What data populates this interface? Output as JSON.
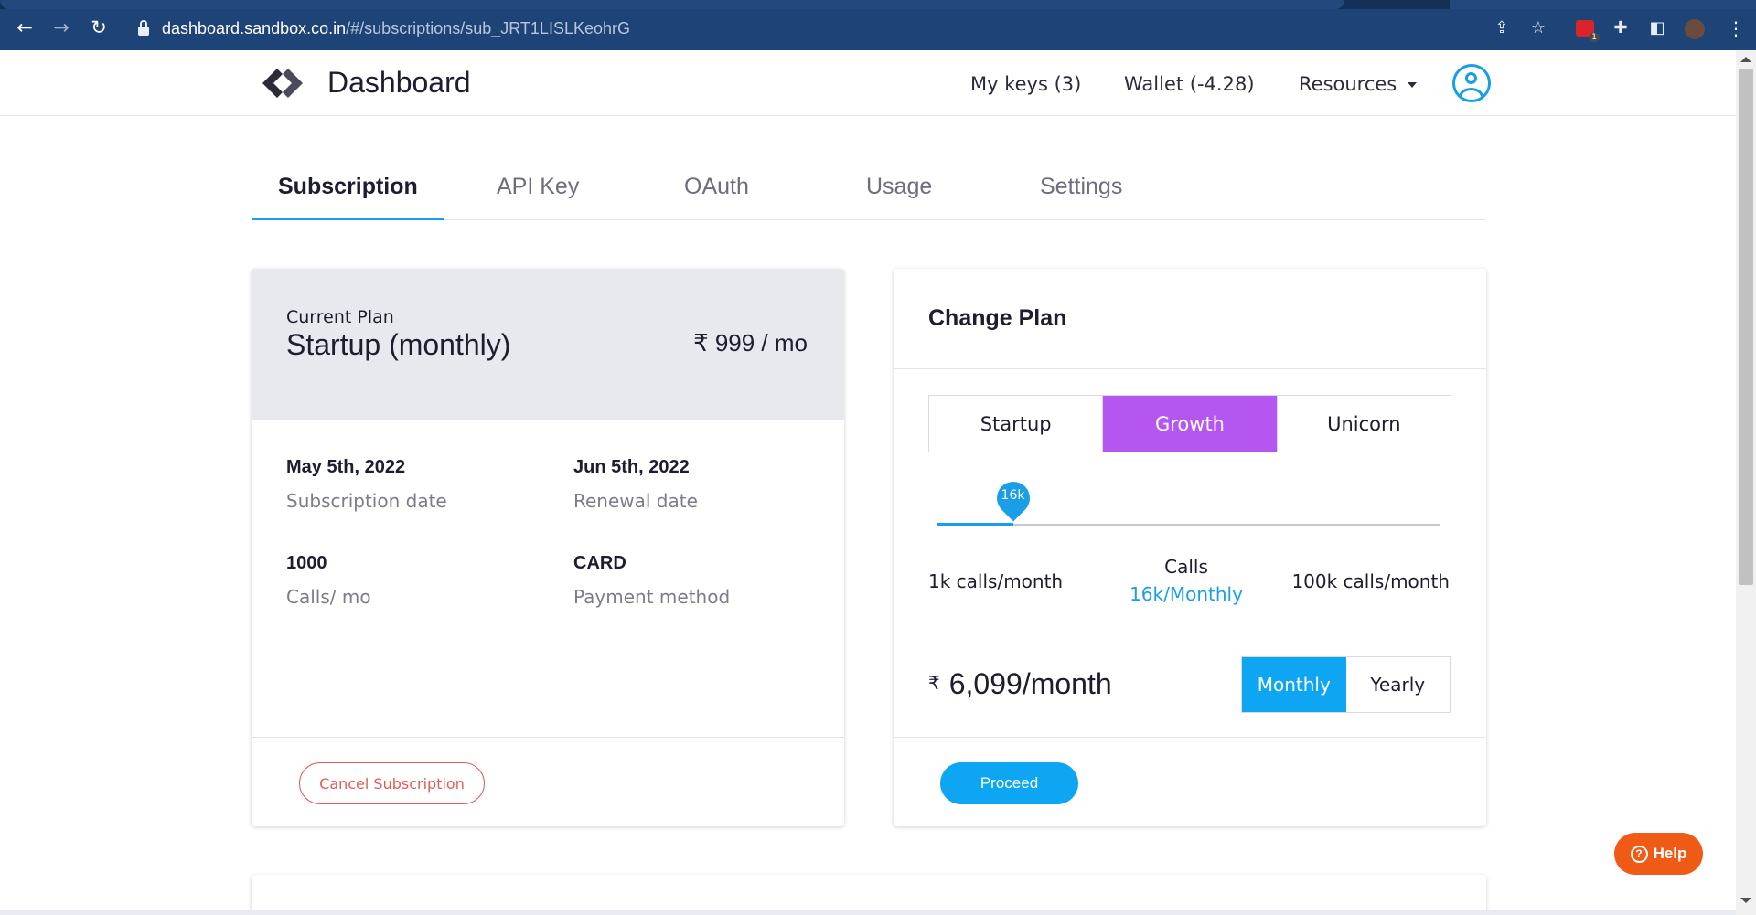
{
  "browser": {
    "url_host": "dashboard.sandbox.co.in",
    "url_path": "/#/subscriptions/sub_JRT1LISLKeohrG",
    "ext_badge": "1"
  },
  "header": {
    "brand": "Dashboard",
    "nav": {
      "my_keys": "My keys (3)",
      "wallet": "Wallet (-4.28)",
      "resources": "Resources"
    }
  },
  "tabs": [
    {
      "label": "Subscription",
      "active": true
    },
    {
      "label": "API Key",
      "active": false
    },
    {
      "label": "OAuth",
      "active": false
    },
    {
      "label": "Usage",
      "active": false
    },
    {
      "label": "Settings",
      "active": false
    }
  ],
  "current_plan": {
    "label": "Current Plan",
    "name": "Startup (monthly)",
    "price": "₹ 999 / mo",
    "subscription_date": {
      "value": "May 5th, 2022",
      "caption": "Subscription date"
    },
    "renewal_date": {
      "value": "Jun 5th, 2022",
      "caption": "Renewal date"
    },
    "calls": {
      "value": "1000",
      "caption": "Calls/ mo"
    },
    "payment": {
      "value": "CARD",
      "caption": "Payment method"
    },
    "cancel_label": "Cancel Subscription"
  },
  "change_plan": {
    "title": "Change Plan",
    "plans": [
      {
        "label": "Startup",
        "active": false
      },
      {
        "label": "Growth",
        "active": true
      },
      {
        "label": "Unicorn",
        "active": false
      }
    ],
    "slider": {
      "value_label": "16k",
      "fraction": 0.15
    },
    "range_min": "1k calls/month",
    "range_max": "100k calls/month",
    "calls_caption": "Calls",
    "calls_value": "16k/Monthly",
    "currency": "₹",
    "price": "6,099/month",
    "billing": [
      {
        "label": "Monthly",
        "active": true
      },
      {
        "label": "Yearly",
        "active": false
      }
    ],
    "proceed_label": "Proceed"
  },
  "help_label": "Help",
  "colors": {
    "accent": "#1a9ee8",
    "growth": "#b456ef",
    "danger": "#e35b52",
    "help": "#ef5a16"
  }
}
